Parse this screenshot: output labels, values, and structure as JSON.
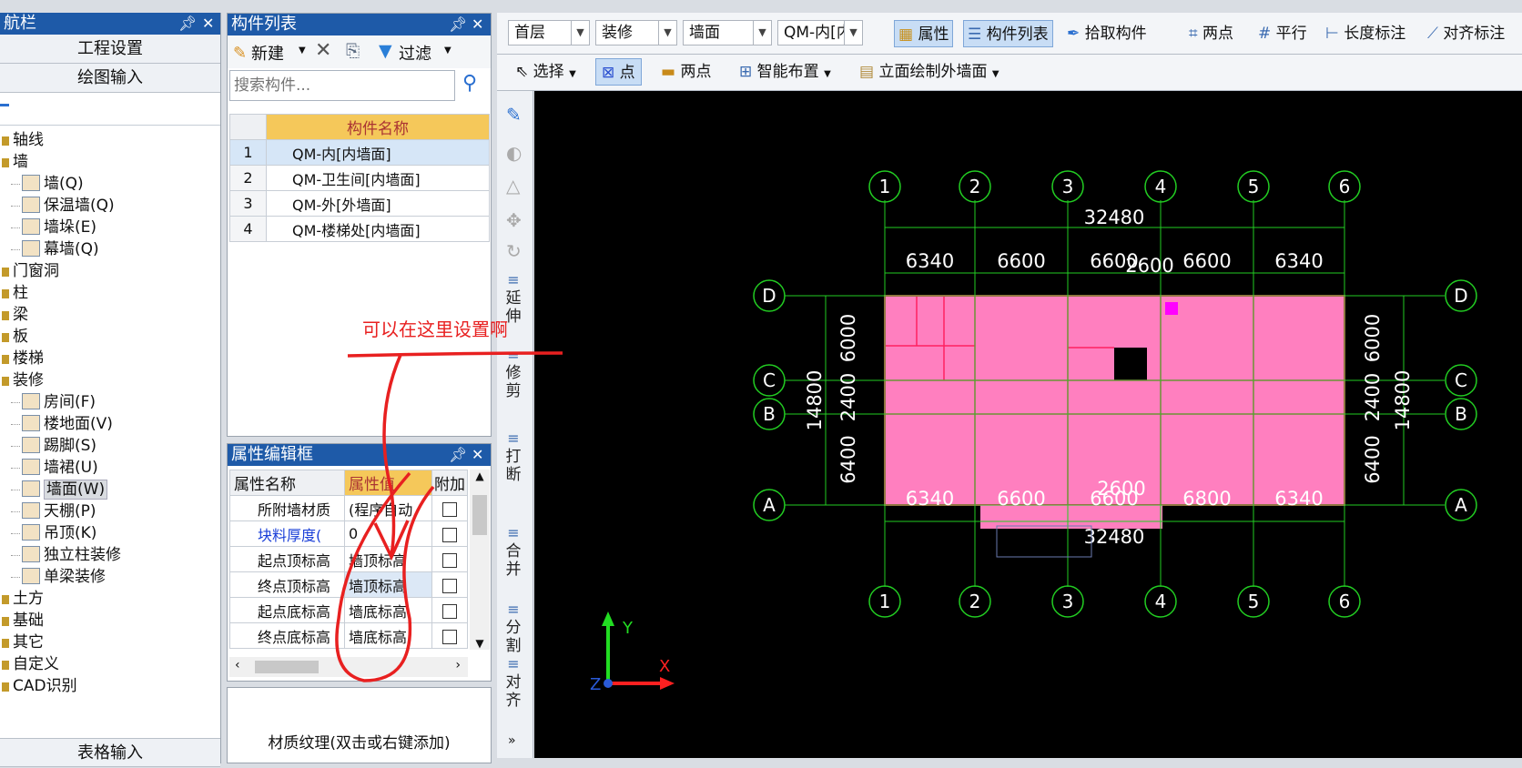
{
  "nav_panel": {
    "title": "航栏",
    "btn_project_settings": "工程设置",
    "btn_drawing_input": "绘图输入",
    "btn_table_input": "表格输入",
    "tree": [
      {
        "label": "轴线",
        "level": 0
      },
      {
        "label": "墙",
        "level": 0
      },
      {
        "label": "墙(Q)",
        "level": 1
      },
      {
        "label": "保温墙(Q)",
        "level": 1
      },
      {
        "label": "墙垛(E)",
        "level": 1
      },
      {
        "label": "幕墙(Q)",
        "level": 1
      },
      {
        "label": "门窗洞",
        "level": 0
      },
      {
        "label": "柱",
        "level": 0
      },
      {
        "label": "梁",
        "level": 0
      },
      {
        "label": "板",
        "level": 0
      },
      {
        "label": "楼梯",
        "level": 0
      },
      {
        "label": "装修",
        "level": 0
      },
      {
        "label": "房间(F)",
        "level": 1
      },
      {
        "label": "楼地面(V)",
        "level": 1
      },
      {
        "label": "踢脚(S)",
        "level": 1
      },
      {
        "label": "墙裙(U)",
        "level": 1
      },
      {
        "label": "墙面(W)",
        "level": 1,
        "selected": true
      },
      {
        "label": "天棚(P)",
        "level": 1
      },
      {
        "label": "吊顶(K)",
        "level": 1
      },
      {
        "label": "独立柱装修",
        "level": 1
      },
      {
        "label": "单梁装修",
        "level": 1
      },
      {
        "label": "土方",
        "level": 0
      },
      {
        "label": "基础",
        "level": 0
      },
      {
        "label": "其它",
        "level": 0
      },
      {
        "label": "自定义",
        "level": 0
      },
      {
        "label": "CAD识别",
        "level": 0
      }
    ]
  },
  "component_list": {
    "title": "构件列表",
    "btn_new": "新建",
    "btn_filter": "过滤",
    "search_placeholder": "搜索构件...",
    "column_header": "构件名称",
    "rows": [
      {
        "num": "1",
        "name": "QM-内[内墙面]"
      },
      {
        "num": "2",
        "name": "QM-卫生间[内墙面]"
      },
      {
        "num": "3",
        "name": "QM-外[外墙面]"
      },
      {
        "num": "4",
        "name": "QM-楼梯处[内墙面]"
      }
    ]
  },
  "annotation": {
    "text": "可以在这里设置啊"
  },
  "property_panel": {
    "title": "属性编辑框",
    "col_name": "属性名称",
    "col_value": "属性值",
    "col_extra": "附加",
    "rows": [
      {
        "name": "所附墙材质",
        "value": "(程序自动",
        "blue": false
      },
      {
        "name": "块料厚度(",
        "value": "0",
        "blue": true
      },
      {
        "name": "起点顶标高",
        "value": "墙顶标高",
        "blue": false
      },
      {
        "name": "终点顶标高",
        "value": "墙顶标高",
        "blue": false
      },
      {
        "name": "起点底标高",
        "value": "墙底标高",
        "blue": false
      },
      {
        "name": "终点底标高",
        "value": "墙底标高",
        "blue": false
      }
    ],
    "texture_label": "材质纹理(双击或右键添加)"
  },
  "toolbar1": {
    "floor": "首层",
    "category": "装修",
    "type": "墙面",
    "component": "QM-内[内",
    "btn_props": "属性",
    "btn_component_list": "构件列表",
    "btn_pick": "拾取构件",
    "btn_two_point": "两点",
    "btn_parallel": "平行",
    "btn_length_dim": "长度标注",
    "btn_align_dim": "对齐标注"
  },
  "toolbar2": {
    "btn_select": "选择",
    "btn_point": "点",
    "btn_two_point": "两点",
    "btn_smart": "智能布置",
    "btn_elevation": "立面绘制外墙面"
  },
  "vertical_tools": [
    "延伸",
    "修剪",
    "打断",
    "合并",
    "分割",
    "对齐"
  ],
  "drawing": {
    "axes_x": [
      "1",
      "2",
      "3",
      "4",
      "5",
      "6"
    ],
    "axes_y": [
      "D",
      "C",
      "B",
      "A"
    ],
    "total_top": "32480",
    "total_bottom": "32480",
    "spans_top": [
      "6340",
      "6600",
      "6600",
      "6600",
      "6340"
    ],
    "spans_bottom": [
      "6340",
      "6600",
      "6600",
      "6800",
      "6340"
    ],
    "mid_top": "2600",
    "mid_bottom": "2600",
    "spans_left": [
      "6000",
      "2400",
      "6400"
    ],
    "total_left": "14800",
    "spans_right": [
      "6000",
      "2400",
      "6400"
    ],
    "total_right": "14800",
    "ucs": {
      "y": "Y",
      "x": "X",
      "z": "Z"
    }
  },
  "colors": {
    "title_blue": "#1e5aa8",
    "wall_pink": "#ff7fbf",
    "axis_green": "#22cc22",
    "annotation_red": "#e82020"
  }
}
